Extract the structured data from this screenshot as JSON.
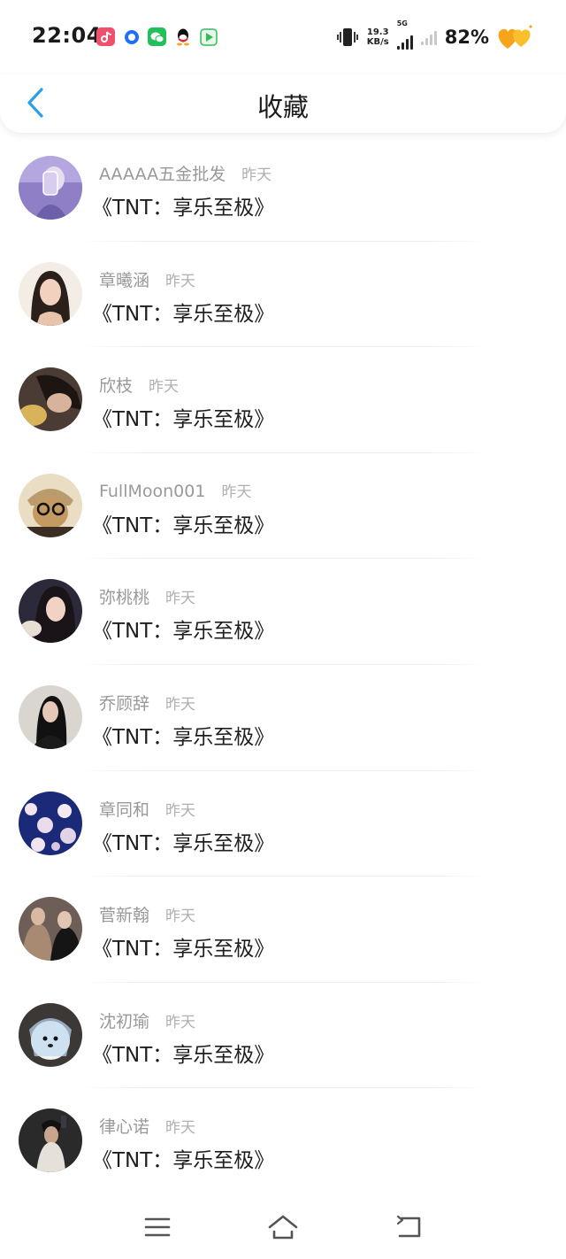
{
  "status_bar": {
    "time": "22:04",
    "apps": [
      "douyin-icon",
      "baidu-netdisk-icon",
      "wechat-icon",
      "qq-icon",
      "iqiyi-icon"
    ],
    "net_speed_value": "19.3",
    "net_speed_unit": "KB/s",
    "network_type": "5G",
    "battery_percent": "82%"
  },
  "header": {
    "title": "收藏",
    "back_icon": "chevron-left-icon",
    "accent_color": "#2a9ee6"
  },
  "favorites": [
    {
      "author": "AAAAA五金批发",
      "time": "昨天",
      "title": "《TNT：享乐至极》"
    },
    {
      "author": "章曦涵",
      "time": "昨天",
      "title": "《TNT：享乐至极》"
    },
    {
      "author": "欣枝",
      "time": "昨天",
      "title": "《TNT：享乐至极》"
    },
    {
      "author": "FullMoon001",
      "time": "昨天",
      "title": "《TNT：享乐至极》"
    },
    {
      "author": "弥桃桃",
      "time": "昨天",
      "title": "《TNT：享乐至极》"
    },
    {
      "author": "乔顾辞",
      "time": "昨天",
      "title": "《TNT：享乐至极》"
    },
    {
      "author": "章同和",
      "time": "昨天",
      "title": "《TNT：享乐至极》"
    },
    {
      "author": "菅新翰",
      "time": "昨天",
      "title": "《TNT：享乐至极》"
    },
    {
      "author": "沈初瑜",
      "time": "昨天",
      "title": "《TNT：享乐至极》"
    },
    {
      "author": "律心诺",
      "time": "昨天",
      "title": "《TNT：享乐至极》"
    }
  ],
  "nav_bar": {
    "menu_icon": "menu-icon",
    "home_icon": "home-icon",
    "back_icon": "back-icon"
  }
}
